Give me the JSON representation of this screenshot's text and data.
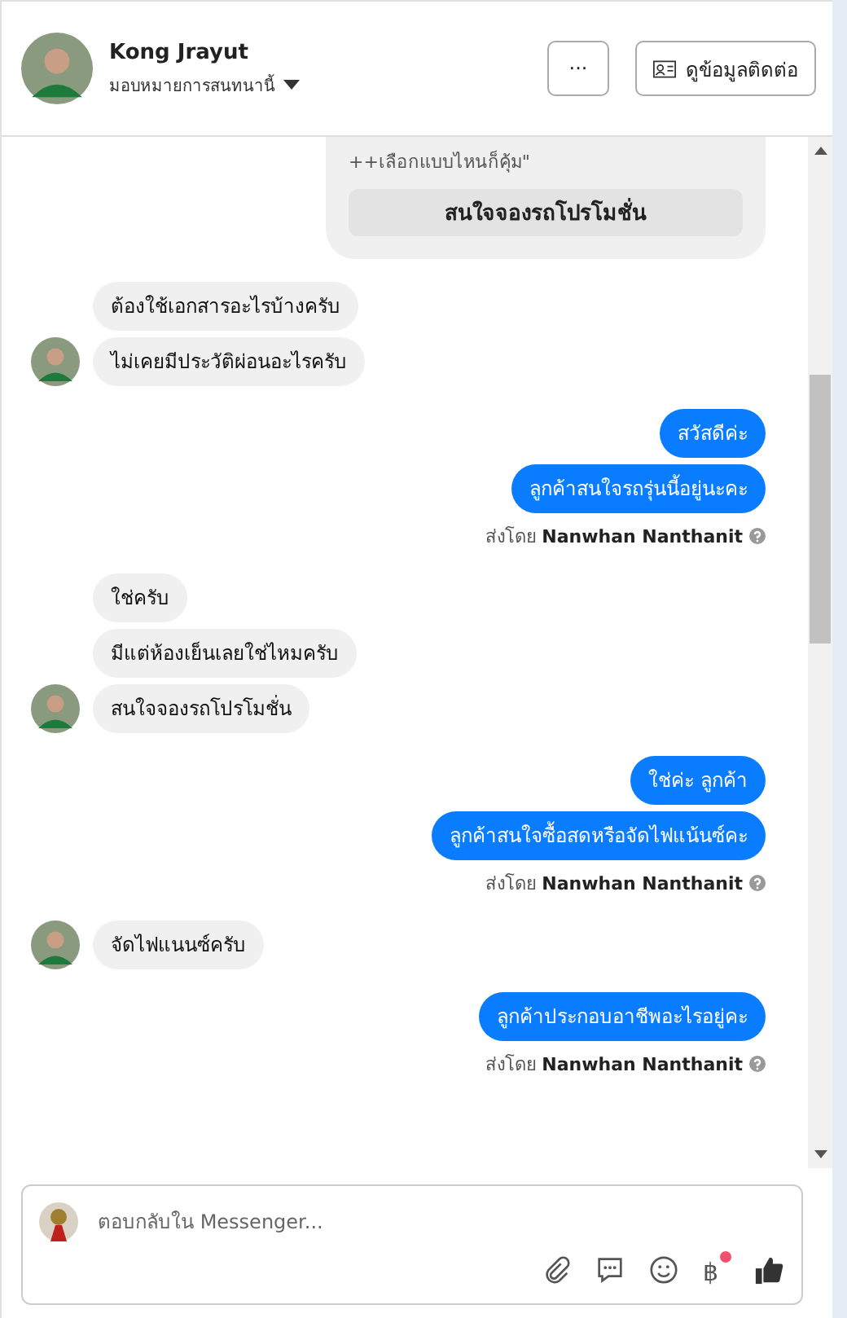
{
  "header": {
    "name": "Kong Jrayut",
    "subtitle": "มอบหมายการสนทนานี้",
    "more_button": "···",
    "contact_button": "ดูข้อมูลติดต่อ"
  },
  "card": {
    "text": "++เลือกแบบไหนก็คุ้ม\"",
    "button": "สนใจจองรถโปรโมชั่น"
  },
  "groups": [
    {
      "kind": "incoming",
      "messages": [
        "ต้องใช้เอกสารอะไรบ้างครับ",
        "ไม่เคยมีประวัติผ่อนอะไรครับ"
      ]
    },
    {
      "kind": "outgoing",
      "messages": [
        "สวัสดีค่ะ",
        "ลูกค้าสนใจรถรุ่นนี้อยู่นะคะ"
      ],
      "sent_by": "ส่งโดย",
      "sender": "Nanwhan Nanthanit"
    },
    {
      "kind": "incoming",
      "messages": [
        "ใช่ครับ",
        "มีแต่ห้องเย็นเลยใช่ไหมครับ",
        "สนใจจองรถโปรโมชั่น"
      ]
    },
    {
      "kind": "outgoing",
      "messages": [
        "ใช่ค่ะ ลูกค้า",
        "ลูกค้าสนใจซื้อสดหรือจัดไฟแน้นซ์คะ"
      ],
      "sent_by": "ส่งโดย",
      "sender": "Nanwhan Nanthanit"
    },
    {
      "kind": "incoming",
      "messages": [
        "จัดไฟแนนซ์ครับ"
      ]
    },
    {
      "kind": "outgoing",
      "messages": [
        "ลูกค้าประกอบอาชีพอะไรอยู่คะ"
      ],
      "sent_by": "ส่งโดย",
      "sender": "Nanwhan Nanthanit"
    }
  ],
  "composer": {
    "placeholder": "ตอบกลับใน Messenger...",
    "currency_symbol": "฿",
    "payment_notification": true
  }
}
